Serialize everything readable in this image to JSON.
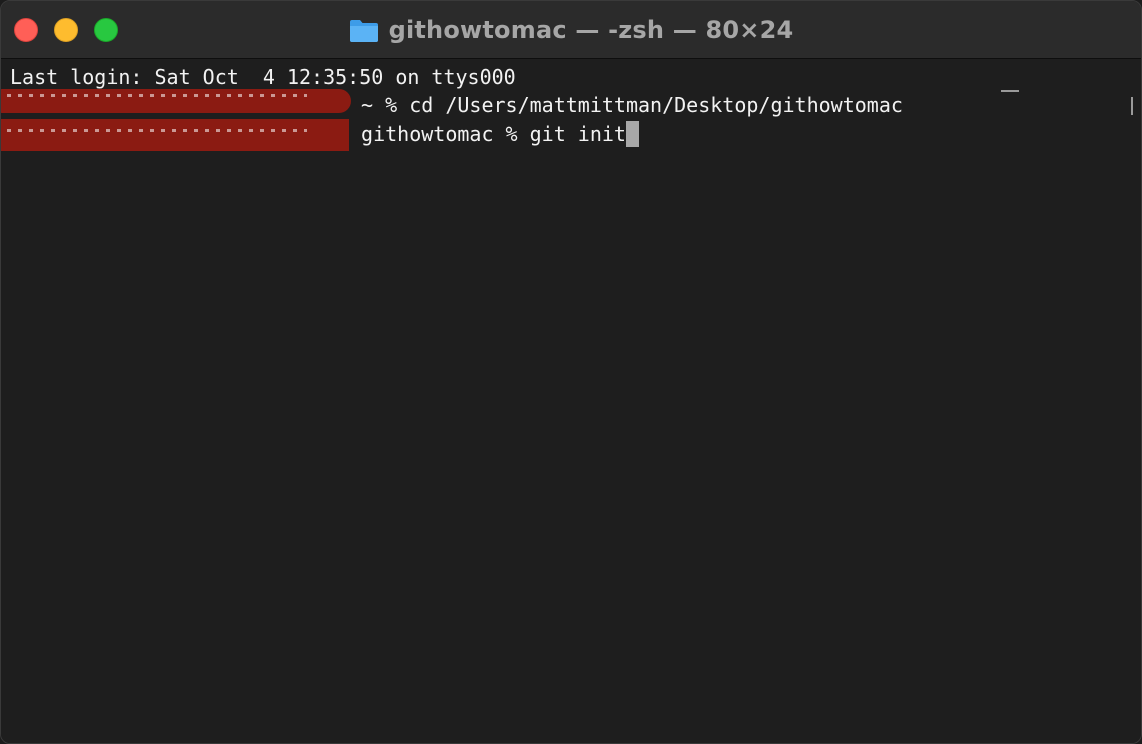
{
  "window": {
    "title": "githowtomac — -zsh — 80×24",
    "folder_icon": "folder-icon",
    "colors": {
      "close": "#ff5f57",
      "minimize": "#febc2e",
      "zoom": "#28c840",
      "background": "#1e1e1e",
      "redaction": "#8b1b12"
    }
  },
  "terminal": {
    "lines": [
      {
        "text": "Last login: Sat Oct  4 12:35:50 on ttys000"
      },
      {
        "prompt_suffix": " ~ % ",
        "command": "cd /Users/mattmittman/Desktop/githowtomac"
      },
      {
        "prompt_suffix": " githowtomac % ",
        "command": "git init"
      }
    ]
  }
}
